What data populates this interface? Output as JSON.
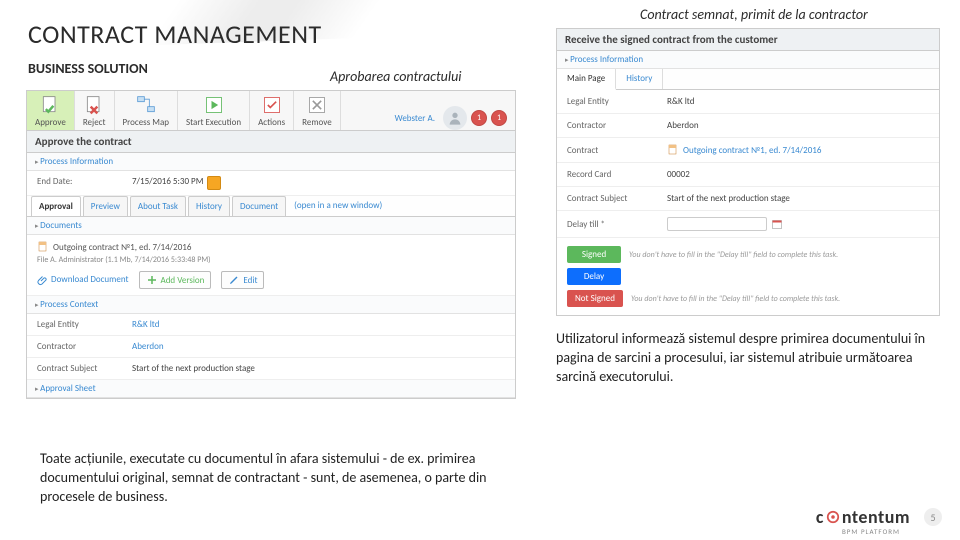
{
  "title": "CONTRACT MANAGEMENT",
  "subtitle": "BUSINESS SOLUTION",
  "caption_left": "Aprobarea contractului",
  "caption_right": "Contract semnat, primit de la contractor",
  "left_panel": {
    "user": "Webster A.",
    "badge1": "1",
    "badge2": "1",
    "toolbar": {
      "approve": "Approve",
      "reject": "Reject",
      "map": "Process Map",
      "start": "Start Execution",
      "actions": "Actions",
      "remove": "Remove"
    },
    "header": "Approve the contract",
    "process_info_sub": "Process Information",
    "end_date_label": "End Date:",
    "end_date_value": "7/15/2016 5:30 PM",
    "tabs": {
      "approval": "Approval",
      "preview": "Preview",
      "about": "About Task",
      "history": "History",
      "document": "Document",
      "open_new": "(open in a new window)"
    },
    "documents_sub": "Documents",
    "doc_title": "Outgoing contract №1, ed. 7/14/2016",
    "doc_sub": "File A. Administrator (1.1 Mb, 7/14/2016 5:33:48 PM)",
    "download": "Download Document",
    "add_version": "Add Version",
    "edit": "Edit",
    "process_context_sub": "Process Context",
    "rows": {
      "legal_entity_l": "Legal Entity",
      "legal_entity_v": "R&K ltd",
      "contractor_l": "Contractor",
      "contractor_v": "Aberdon",
      "contract_subject_l": "Contract Subject",
      "contract_subject_v": "Start of the next production stage"
    },
    "approval_sheet_sub": "Approval Sheet"
  },
  "right_panel": {
    "header": "Receive the signed contract from the customer",
    "process_info_sub": "Process Information",
    "tabs": {
      "main": "Main Page",
      "history": "History"
    },
    "rows": {
      "legal_entity_l": "Legal Entity",
      "legal_entity_v": "R&K ltd",
      "contractor_l": "Contractor",
      "contractor_v": "Aberdon",
      "contract_l": "Contract",
      "contract_v": "Outgoing contract №1, ed. 7/14/2016",
      "record_l": "Record Card",
      "record_v": "00002",
      "subject_l": "Contract Subject",
      "subject_v": "Start of the next production stage",
      "delay_l": "Delay till *"
    },
    "buttons": {
      "signed": "Signed",
      "signed_hint": "You don't have to fill in the \"Delay till\" field to complete this task.",
      "delay": "Delay",
      "notsigned": "Not Signed",
      "notsigned_hint": "You don't have to fill in the \"Delay till\" field to complete this task."
    }
  },
  "para_right": "Utilizatorul informează sistemul despre primirea documentului în pagina de sarcini a procesului, iar sistemul atribuie următoarea sarcină executorului.",
  "para_left": "Toate acțiunile, executate cu documentul în afara sistemului - de ex. primirea documentului original, semnat de contractant - sunt, de asemenea, o parte din procesele de business.",
  "logo": {
    "pre": "c",
    "o1": "o",
    "mid": "ntentum",
    "sub": "BPM PLATFORM"
  },
  "page_number": "5"
}
